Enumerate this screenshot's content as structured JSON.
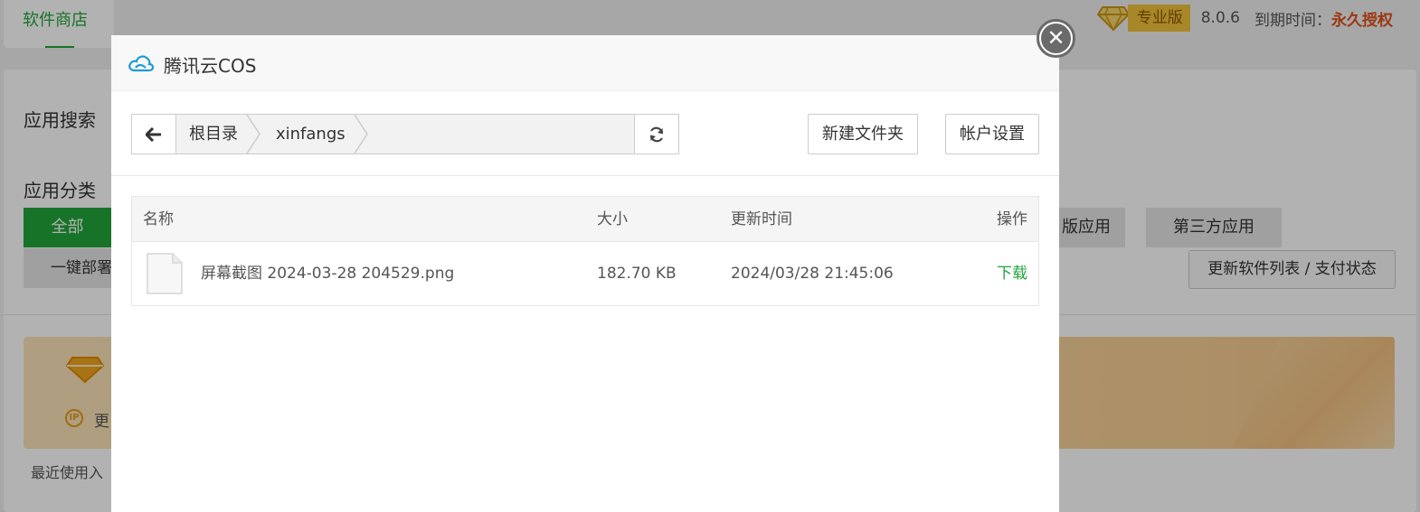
{
  "background": {
    "top_tab": "软件商店",
    "vip": {
      "badge": "专业版",
      "version": "8.0.6",
      "expire_label": "到期时间：",
      "expire_value": "永久授权"
    },
    "search_label": "应用搜索",
    "category_label": "应用分类",
    "categories": {
      "all": "全部",
      "partial1": "版应用",
      "third_party": "第三方应用",
      "one_click": "一键部署"
    },
    "refresh_list_btn": "更新软件列表 / 支付状态",
    "banner_more": "更",
    "recent_label": "最近使用入"
  },
  "modal": {
    "title": "腾讯云COS",
    "close_icon": "close-icon",
    "path": [
      "根目录",
      "xinfangs"
    ],
    "new_folder_btn": "新建文件夹",
    "account_btn": "帐户设置",
    "table": {
      "headers": {
        "name": "名称",
        "size": "大小",
        "time": "更新时间",
        "op": "操作"
      },
      "rows": [
        {
          "name": "屏幕截图 2024-03-28 204529.png",
          "size": "182.70 KB",
          "time": "2024/03/28 21:45:06",
          "op": "下载"
        }
      ]
    }
  },
  "colors": {
    "accent": "#20a53a",
    "forever": "#e0501b",
    "pro_badge": "#f0c23a"
  }
}
